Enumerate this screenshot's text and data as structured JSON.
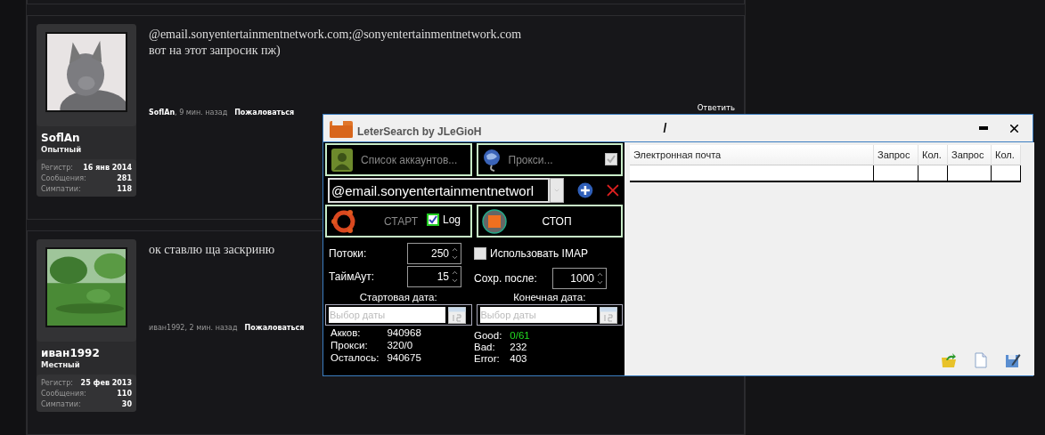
{
  "forum": {
    "posts": [
      {
        "author": "SoflAn",
        "rank": "Опытный",
        "avatar": {
          "kind": "picture"
        },
        "stats": [
          {
            "label": "Регистр:",
            "value": "16 янв 2014"
          },
          {
            "label": "Сообщения:",
            "value": "281"
          },
          {
            "label": "Симпатии:",
            "value": "118"
          }
        ],
        "message": [
          "@email.sonyentertainmentnetwork.com;@sonyentertainmentnetwork.com",
          "вот на этот запросик пж)"
        ],
        "meta": "**SoflAn**, 9 мин. назад",
        "report": "Пожаловаться",
        "reply": "Ответить"
      },
      {
        "author": "иван1992",
        "rank": "Местный",
        "avatar": {
          "kind": "picture"
        },
        "stats": [
          {
            "label": "Регистр:",
            "value": "25 фев 2013"
          },
          {
            "label": "Сообщения:",
            "value": "110"
          },
          {
            "label": "Симпатии:",
            "value": "30"
          }
        ],
        "message": [
          "ок ставлю ща заскриню"
        ],
        "meta": "иван1992, 2 мин. назад",
        "report": "Пожаловаться"
      }
    ]
  },
  "app": {
    "title": "LeterSearch by JLeGioH",
    "title_mark": "/",
    "accounts_button": "Список аккаунтов...",
    "proxy_button": {
      "label": "Прокси...",
      "checked": true
    },
    "query_field": {
      "value": "@email.sonyentertainmentnetworl"
    },
    "start_button": {
      "label": "СТАРТ",
      "disabled": true
    },
    "log": {
      "label": "Log",
      "checked": true
    },
    "stop_button": {
      "label": "СТОП",
      "disabled": false
    },
    "threads": {
      "label": "Потоки:",
      "value": "250"
    },
    "timeout": {
      "label": "ТаймАут:",
      "value": "15"
    },
    "imap": {
      "label": "Использовать IMAP",
      "checked": false
    },
    "save_after": {
      "label": "Сохр. после:",
      "value": "1000"
    },
    "dates": [
      {
        "label": "Стартовая дата:",
        "placeholder": "Выбор даты"
      },
      {
        "label": "Конечная дата:",
        "placeholder": "Выбор даты"
      }
    ],
    "stats_left": [
      {
        "label": "Акков:",
        "value": "940968"
      },
      {
        "label": "Прокси:",
        "value": "320/0"
      },
      {
        "label": "Осталось:",
        "value": "940675"
      }
    ],
    "stats_right": [
      {
        "label": "Good:",
        "value": "0/61",
        "color": "#22dd22"
      },
      {
        "label": "Bad:",
        "value": "232",
        "color": "#ffffff"
      },
      {
        "label": "Error:",
        "value": "403",
        "color": "#ffffff"
      }
    ],
    "table": {
      "columns": [
        "Электронная почта",
        "Запрос",
        "Кол.",
        "Запрос",
        "Кол."
      ]
    }
  }
}
